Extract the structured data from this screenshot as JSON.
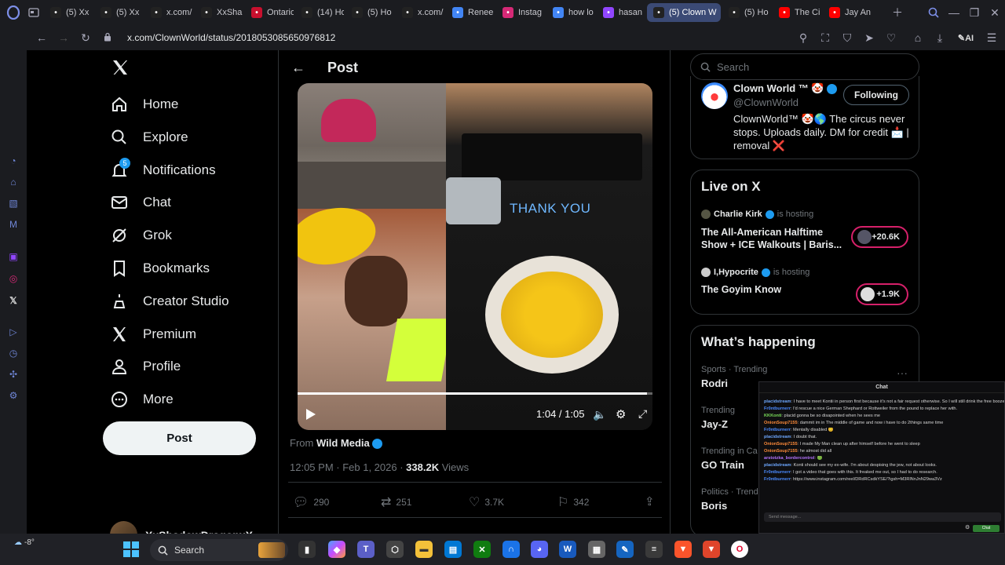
{
  "browser": {
    "tabs": [
      {
        "label": "(5) Xx",
        "color": "#222"
      },
      {
        "label": "(5) Xx",
        "color": "#222"
      },
      {
        "label": "x.com/",
        "color": "#222"
      },
      {
        "label": "XxSha",
        "color": "#222"
      },
      {
        "label": "Ontario",
        "color": "#c8102e"
      },
      {
        "label": "(14) Ho",
        "color": "#222"
      },
      {
        "label": "(5) Ho",
        "color": "#222"
      },
      {
        "label": "x.com/",
        "color": "#222"
      },
      {
        "label": "Renee",
        "color": "#4285f4"
      },
      {
        "label": "Instag",
        "color": "#d62976"
      },
      {
        "label": "how lo",
        "color": "#4285f4"
      },
      {
        "label": "hasan",
        "color": "#9146ff"
      },
      {
        "label": "(5) Clown W",
        "color": "#222"
      },
      {
        "label": "(5) Ho",
        "color": "#222"
      },
      {
        "label": "The Ci",
        "color": "#ff0000"
      },
      {
        "label": "Jay An",
        "color": "#ff0000"
      }
    ],
    "url": "x.com/ClownWorld/status/2018053085650976812",
    "ai_label": "AI"
  },
  "nav": {
    "items": [
      {
        "label": "Home",
        "icon": "home-icon"
      },
      {
        "label": "Explore",
        "icon": "search-icon"
      },
      {
        "label": "Notifications",
        "icon": "bell-icon"
      },
      {
        "label": "Chat",
        "icon": "mail-icon"
      },
      {
        "label": "Grok",
        "icon": "grok-icon"
      },
      {
        "label": "Bookmarks",
        "icon": "bookmark-icon"
      },
      {
        "label": "Creator Studio",
        "icon": "creator-icon"
      },
      {
        "label": "Premium",
        "icon": "x-icon"
      },
      {
        "label": "Profile",
        "icon": "person-icon"
      },
      {
        "label": "More",
        "icon": "more-icon"
      }
    ],
    "notif_count": "5",
    "post_label": "Post",
    "account_name": "XxShadowDragonxX"
  },
  "post": {
    "header": "Post",
    "overlay_text": "THANK YOU",
    "time": "1:04 / 1:05",
    "progress": 0.985,
    "from_prefix": "From",
    "from_name": "Wild Media",
    "date": "12:05 PM · Feb 1, 2026 ·",
    "views_count": "338.2K",
    "views_label": "Views",
    "replies": "290",
    "reposts": "251",
    "likes": "3.7K",
    "bookmarks": "342"
  },
  "right": {
    "search_placeholder": "Search",
    "profile": {
      "name": "Clown World ™ 🤡",
      "handle": "@ClownWorld",
      "follow_label": "Following",
      "bio": "ClownWorld™ 🤡🌎 The circus never stops. Uploads daily. DM for credit 📩 | removal ❌"
    },
    "live": {
      "title": "Live on X",
      "items": [
        {
          "host": "Charlie Kirk",
          "hosting": "is hosting",
          "title": "The All-American Halftime Show + ICE Walkouts | Baris...",
          "count": "+20.6K"
        },
        {
          "host": "I,Hypocrite",
          "hosting": "is hosting",
          "title": "The Goyim Know",
          "count": "+1.9K"
        }
      ]
    },
    "happening": {
      "title": "What’s happening",
      "items": [
        {
          "meta": "Sports · Trending",
          "topic": "Rodri"
        },
        {
          "meta": "Trending",
          "topic": "Jay-Z"
        },
        {
          "meta": "Trending in Ca",
          "topic": "GO Train"
        },
        {
          "meta": "Politics · Trend",
          "topic": "Boris"
        }
      ]
    }
  },
  "chat": {
    "title": "Chat",
    "messages": [
      {
        "user": "placidstream",
        "color": "#6ea8ff",
        "text": "I have to meet Kontii in person first because it's not a fair request otherwise. So I will still drink the free booze that presents itself."
      },
      {
        "user": "Fr0ntburnerr",
        "color": "#4b8bff",
        "text": "I'd rescue a nice German Shephard or Rottweiler from the pound to replace her with."
      },
      {
        "user": "KKKonti",
        "color": "#7adf5a",
        "text": "placid gonna be so disapointed when he sees me"
      },
      {
        "user": "OnionSoup7155",
        "color": "#ff8c3a",
        "text": "dammit im in The middle of game and now i have to do 2things same time"
      },
      {
        "user": "Fr0ntburnerr",
        "color": "#4b8bff",
        "text": "Mentally disabled 😊"
      },
      {
        "user": "placidstream",
        "color": "#6ea8ff",
        "text": "I doubt that."
      },
      {
        "user": "OnionSoup7155",
        "color": "#ff8c3a",
        "text": "I made My Man clean up after himself before he went to sleep"
      },
      {
        "user": "OnionSoup7155",
        "color": "#ff8c3a",
        "text": "he almost did all"
      },
      {
        "user": "arstotzka_bordercontrol",
        "color": "#b574ff",
        "text": "🟢"
      },
      {
        "user": "placidstream",
        "color": "#6ea8ff",
        "text": "Konti should see my ex-wife. I'm about despising the jew, not about looks."
      },
      {
        "user": "Fr0ntburnerr",
        "color": "#4b8bff",
        "text": "I got a video that goes with this. It freaked me out, so I had to do research."
      },
      {
        "user": "Fr0ntburnerr",
        "color": "#4b8bff",
        "text": "https://www.instagram.com/reel/DRdRCsdkYSE/?igsh=M3RlNnJnN29wa3Vz"
      }
    ],
    "input_placeholder": "Send message...",
    "send_label": "Chat"
  },
  "taskbar": {
    "weather": "-8°",
    "search_label": "Search"
  }
}
